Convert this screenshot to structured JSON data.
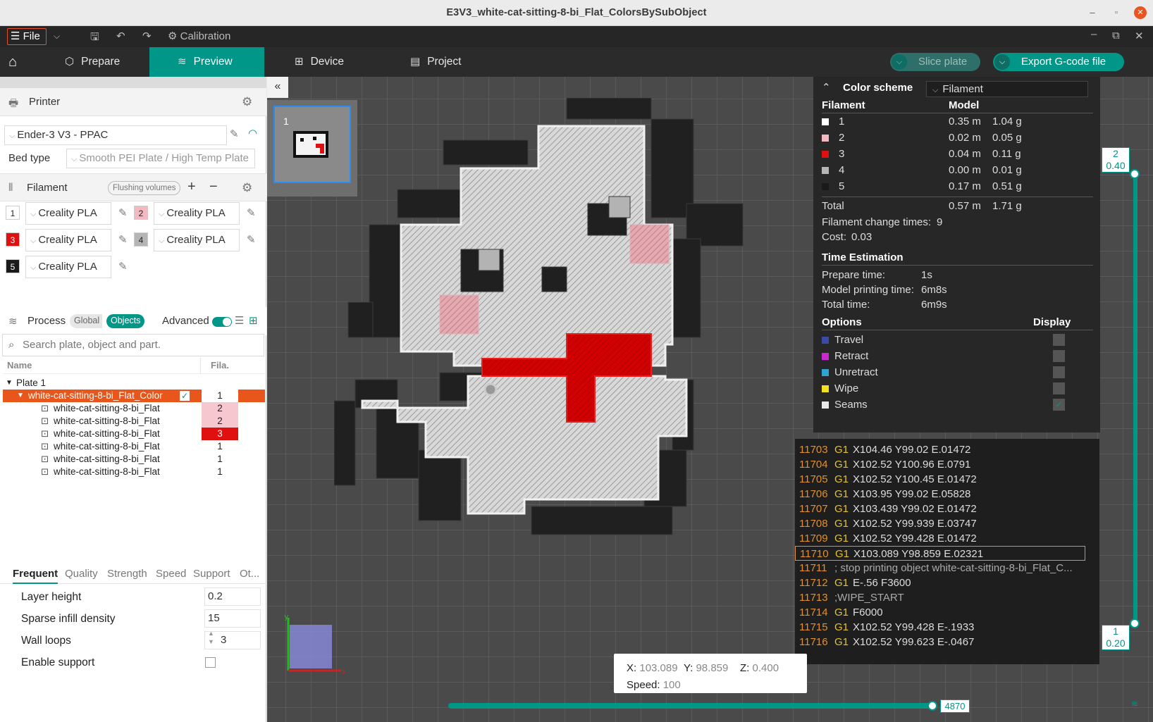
{
  "window": {
    "title": "E3V3_white-cat-sitting-8-bi_Flat_ColorsBySubObject"
  },
  "menu": {
    "file": "File",
    "calibration": "Calibration"
  },
  "tabs": [
    {
      "label": "Prepare",
      "active": false
    },
    {
      "label": "Preview",
      "active": true
    },
    {
      "label": "Device",
      "active": false
    },
    {
      "label": "Project",
      "active": false
    }
  ],
  "actions": {
    "slice_plate": "Slice plate",
    "export": "Export G-code file"
  },
  "printer": {
    "section": "Printer",
    "name": "Ender-3 V3 - PPAC",
    "bed_type_label": "Bed type",
    "bed_type": "Smooth PEI Plate / High Temp Plate"
  },
  "filament": {
    "section": "Filament",
    "flushing": "Flushing volumes",
    "items": [
      {
        "id": "1",
        "name": "Creality  PLA",
        "color": "#ffffff",
        "text_color": "#222222"
      },
      {
        "id": "2",
        "name": "Creality  PLA",
        "color": "#f4b8c0",
        "text_color": "#222222"
      },
      {
        "id": "3",
        "name": "Creality  PLA",
        "color": "#e01010",
        "text_color": "#ffffff"
      },
      {
        "id": "4",
        "name": "Creality  PLA",
        "color": "#b5b5b5",
        "text_color": "#222222"
      },
      {
        "id": "5",
        "name": "Creality  PLA",
        "color": "#1a1a1a",
        "text_color": "#ffffff"
      }
    ]
  },
  "process": {
    "section": "Process",
    "global": "Global",
    "objects": "Objects",
    "advanced": "Advanced",
    "search_placeholder": "Search plate, object and part."
  },
  "object_list": {
    "col_name": "Name",
    "col_fila": "Fila.",
    "plate": "Plate 1",
    "object": {
      "name": "white-cat-sitting-8-bi_Flat_Color",
      "fila": "1"
    },
    "parts": [
      {
        "name": "white-cat-sitting-8-bi_Flat",
        "fila": "2",
        "color": "#f6c7cf"
      },
      {
        "name": "white-cat-sitting-8-bi_Flat",
        "fila": "2",
        "color": "#f6c7cf"
      },
      {
        "name": "white-cat-sitting-8-bi_Flat",
        "fila": "3",
        "color": "#e01010"
      },
      {
        "name": "white-cat-sitting-8-bi_Flat",
        "fila": "1",
        "color": "#ffffff"
      },
      {
        "name": "white-cat-sitting-8-bi_Flat",
        "fila": "1",
        "color": "#ffffff"
      },
      {
        "name": "white-cat-sitting-8-bi_Flat",
        "fila": "1",
        "color": "#ffffff"
      }
    ]
  },
  "param_tabs": [
    "Frequent",
    "Quality",
    "Strength",
    "Speed",
    "Support",
    "Ot..."
  ],
  "params": {
    "layer_height_label": "Layer height",
    "layer_height": "0.2",
    "infill_label": "Sparse infill density",
    "infill": "15",
    "wall_loops_label": "Wall loops",
    "wall_loops": "3",
    "support_label": "Enable support"
  },
  "plate_thumb": {
    "number": "1"
  },
  "legend": {
    "title": "Color scheme",
    "scheme": "Filament",
    "col_filament": "Filament",
    "col_model": "Model",
    "rows": [
      {
        "id": "1",
        "len": "0.35 m",
        "weight": "1.04 g",
        "color": "#ffffff"
      },
      {
        "id": "2",
        "len": "0.02 m",
        "weight": "0.05 g",
        "color": "#f4b8c0"
      },
      {
        "id": "3",
        "len": "0.04 m",
        "weight": "0.11 g",
        "color": "#e01010"
      },
      {
        "id": "4",
        "len": "0.00 m",
        "weight": "0.01 g",
        "color": "#b5b5b5"
      },
      {
        "id": "5",
        "len": "0.17 m",
        "weight": "0.51 g",
        "color": "#1a1a1a"
      }
    ],
    "total_label": "Total",
    "total_len": "0.57 m",
    "total_weight": "1.71 g",
    "change_label": "Filament change times:",
    "change_value": "9",
    "cost_label": "Cost:",
    "cost_value": "0.03",
    "time_title": "Time Estimation",
    "prepare_label": "Prepare time:",
    "prepare_value": "1s",
    "model_label": "Model printing time:",
    "model_value": "6m8s",
    "total_time_label": "Total time:",
    "total_time_value": "6m9s",
    "options_title": "Options",
    "display_title": "Display",
    "options": [
      {
        "label": "Travel",
        "color": "#3a4aa8",
        "checked": false
      },
      {
        "label": "Retract",
        "color": "#c82ad0",
        "checked": false
      },
      {
        "label": "Unretract",
        "color": "#2aa6d0",
        "checked": false
      },
      {
        "label": "Wipe",
        "color": "#f0e020",
        "checked": false
      },
      {
        "label": "Seams",
        "color": "#e8e8e8",
        "checked": true
      }
    ]
  },
  "gcode": [
    {
      "n": "11703",
      "cmd": "G1",
      "args": "X104.46 Y99.02 E.01472",
      "current": false
    },
    {
      "n": "11704",
      "cmd": "G1",
      "args": "X102.52 Y100.96 E.0791",
      "current": false
    },
    {
      "n": "11705",
      "cmd": "G1",
      "args": "X102.52 Y100.45 E.01472",
      "current": false
    },
    {
      "n": "11706",
      "cmd": "G1",
      "args": "X103.95 Y99.02 E.05828",
      "current": false
    },
    {
      "n": "11707",
      "cmd": "G1",
      "args": "X103.439 Y99.02 E.01472",
      "current": false
    },
    {
      "n": "11708",
      "cmd": "G1",
      "args": "X102.52 Y99.939 E.03747",
      "current": false
    },
    {
      "n": "11709",
      "cmd": "G1",
      "args": "X102.52 Y99.428 E.01472",
      "current": false
    },
    {
      "n": "11710",
      "cmd": "G1",
      "args": "X103.089 Y98.859 E.02321",
      "current": true
    },
    {
      "n": "11711",
      "cmd": "",
      "args": "; stop printing object white-cat-sitting-8-bi_Flat_C...",
      "current": false
    },
    {
      "n": "11712",
      "cmd": "G1",
      "args": "E-.56 F3600",
      "current": false
    },
    {
      "n": "11713",
      "cmd": "",
      "args": ";WIPE_START",
      "current": false
    },
    {
      "n": "11714",
      "cmd": "G1",
      "args": "F6000",
      "current": false
    },
    {
      "n": "11715",
      "cmd": "G1",
      "args": "X102.52 Y99.428 E-.1933",
      "current": false
    },
    {
      "n": "11716",
      "cmd": "G1",
      "args": "X102.52 Y99.623 E-.0467",
      "current": false
    }
  ],
  "position": {
    "x_label": "X:",
    "x": "103.089",
    "y_label": "Y:",
    "y": "98.859",
    "z_label": "Z:",
    "z": "0.400",
    "speed_label": "Speed:",
    "speed": "100"
  },
  "layer_slider": {
    "top_layer": "2",
    "top_z": "0.40",
    "bottom_layer": "1",
    "bottom_z": "0.20"
  },
  "move_slider": {
    "value": "4870"
  },
  "axes": {
    "x": "x",
    "y": "y"
  }
}
